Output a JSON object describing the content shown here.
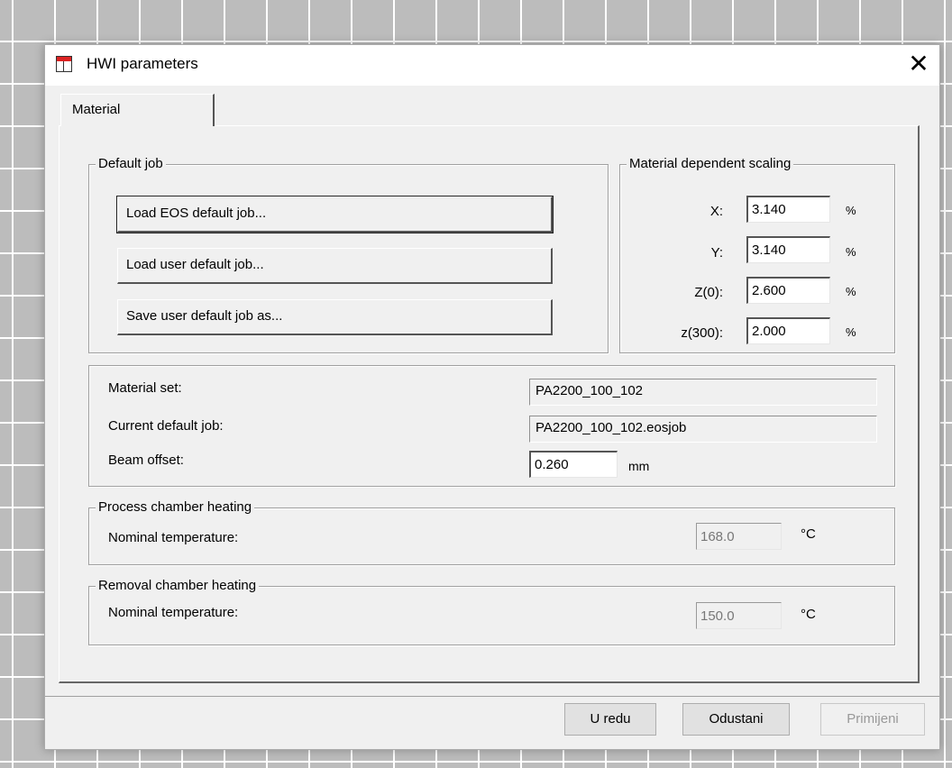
{
  "window": {
    "title": "HWI parameters",
    "close_symbol": "✕"
  },
  "tabs": [
    {
      "label": "Material"
    }
  ],
  "default_job": {
    "legend": "Default job",
    "buttons": [
      "Load EOS default job...",
      "Load user default job...",
      "Save user default job as..."
    ]
  },
  "scaling": {
    "legend": "Material dependent scaling",
    "rows": [
      {
        "label": "X:",
        "value": "3.140",
        "unit": "%"
      },
      {
        "label": "Y:",
        "value": "3.140",
        "unit": "%"
      },
      {
        "label": "Z(0):",
        "value": "2.600",
        "unit": "%"
      },
      {
        "label": "z(300):",
        "value": "2.000",
        "unit": "%"
      }
    ]
  },
  "material_info": {
    "material_set_label": "Material set:",
    "material_set_value": "PA2200_100_102",
    "current_job_label": "Current default job:",
    "current_job_value": "PA2200_100_102.eosjob",
    "beam_offset_label": "Beam offset:",
    "beam_offset_value": "0.260",
    "beam_offset_unit": "mm"
  },
  "process_heating": {
    "legend": "Process chamber heating",
    "label": "Nominal temperature:",
    "value": "168.0",
    "unit": "°C"
  },
  "removal_heating": {
    "legend": "Removal chamber heating",
    "label": "Nominal temperature:",
    "value": "150.0",
    "unit": "°C"
  },
  "footer": {
    "ok_label": "U redu",
    "cancel_label": "Odustani",
    "apply_label": "Primijeni"
  }
}
